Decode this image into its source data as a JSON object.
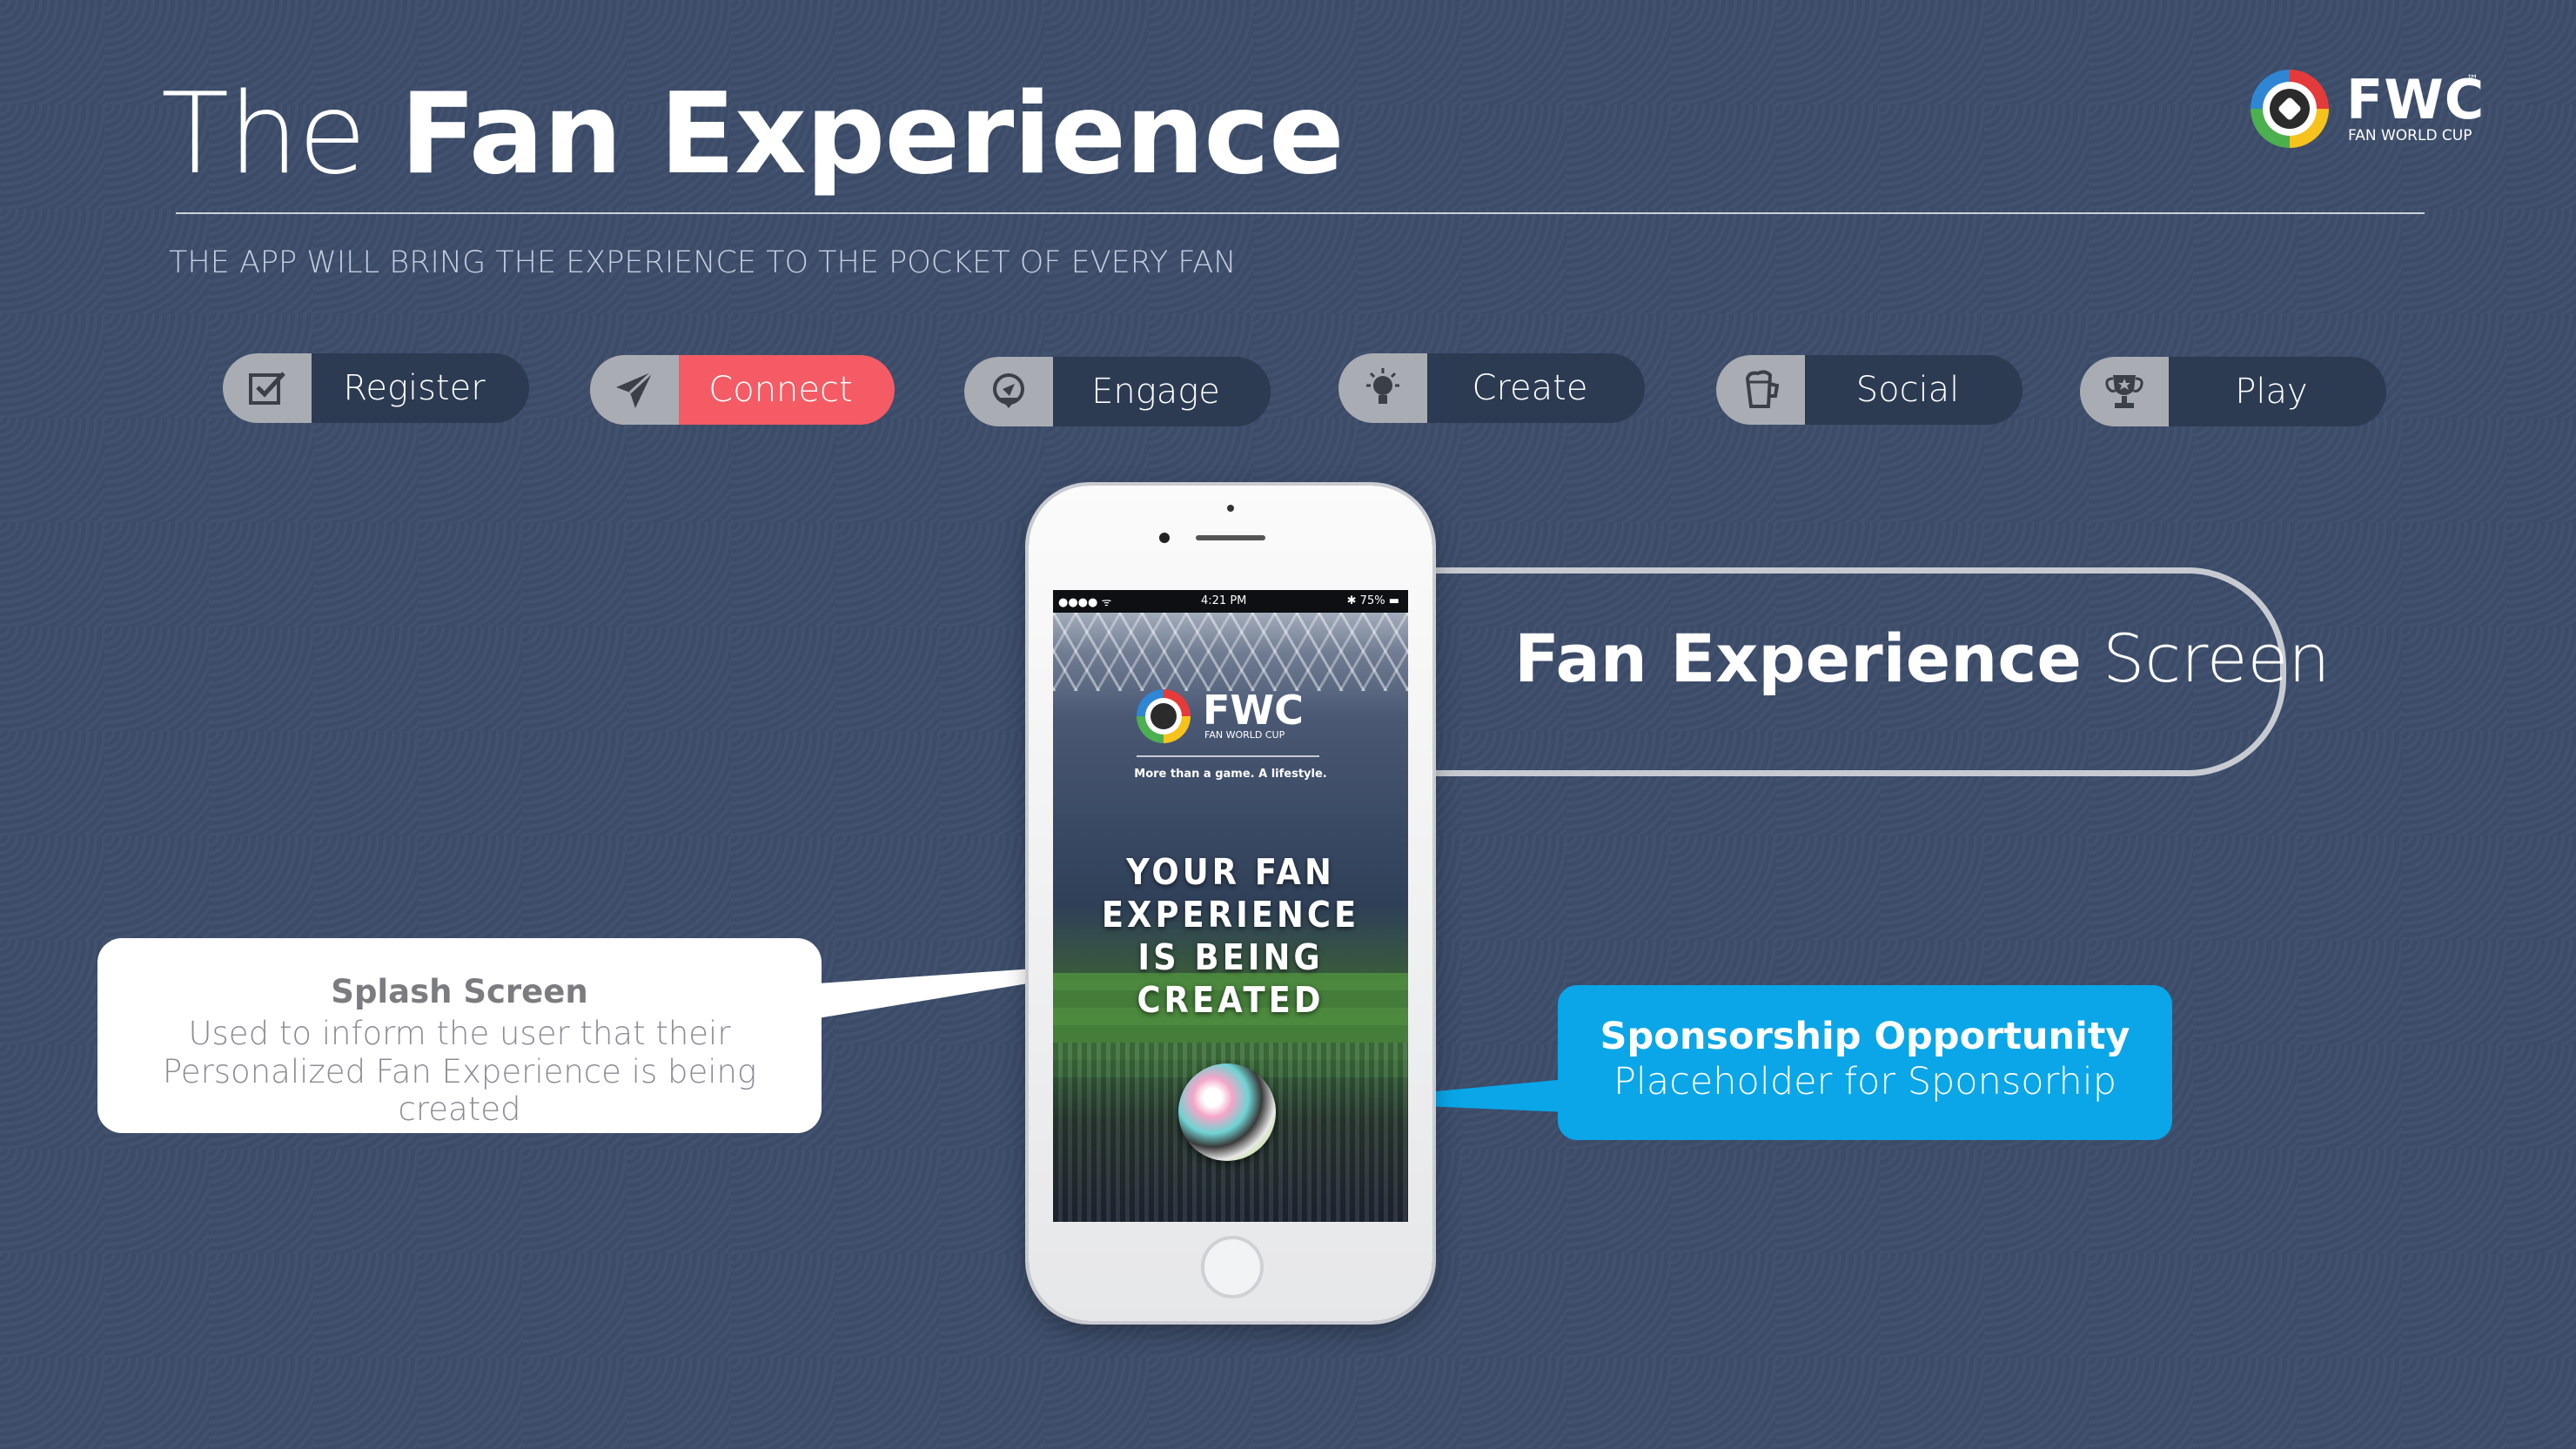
{
  "header": {
    "title_light": "The",
    "title_bold": "Fan Experience",
    "subtitle": "THE APP WILL BRING THE EXPERIENCE TO THE POCKET OF EVERY FAN"
  },
  "logo": {
    "name": "FWC",
    "trademark": "™",
    "tagline": "FAN WORLD CUP"
  },
  "nav": {
    "items": [
      {
        "label": "Register",
        "icon": "checkbox-icon",
        "active": false
      },
      {
        "label": "Connect",
        "icon": "paper-plane-icon",
        "active": true
      },
      {
        "label": "Engage",
        "icon": "location-pin-icon",
        "active": false
      },
      {
        "label": "Create",
        "icon": "lightbulb-icon",
        "active": false
      },
      {
        "label": "Social",
        "icon": "beer-mug-icon",
        "active": false
      },
      {
        "label": "Play",
        "icon": "trophy-icon",
        "active": false
      }
    ],
    "active_color": "#f45b64"
  },
  "phone": {
    "status_signal": "●●●● ᯤ",
    "status_time": "4:21 PM",
    "status_battery": "✱ 75% ▬",
    "logo_name": "FWC",
    "logo_sub": "FAN WORLD CUP",
    "tagline": "More than a game. A lifestyle.",
    "headline_lines": [
      "YOUR FAN",
      "EXPERIENCE",
      "IS BEING",
      "CREATED"
    ]
  },
  "callouts": {
    "screen_title_bold": "Fan Experience",
    "screen_title_light": "Screen",
    "splash": {
      "title": "Splash Screen",
      "line1": "Used to inform the user that their",
      "line2": "Personalized Fan Experience is being created"
    },
    "sponsor": {
      "title": "Sponsorship Opportunity",
      "desc": "Placeholder for Sponsorhip",
      "color": "#0aa6e8"
    }
  }
}
